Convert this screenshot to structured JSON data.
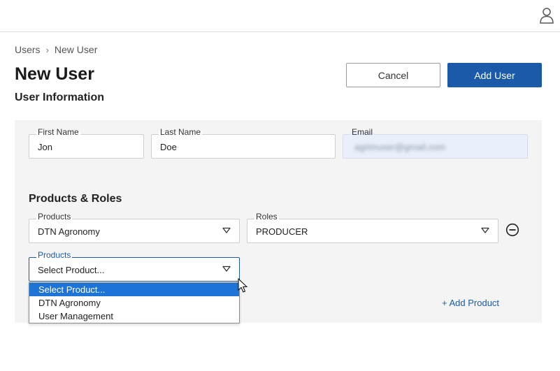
{
  "header": {
    "user_icon": "user-icon"
  },
  "breadcrumb": {
    "items": [
      "Users",
      "New User"
    ],
    "separator": "›"
  },
  "page": {
    "title": "New User",
    "section_title": "User Information"
  },
  "actions": {
    "cancel_label": "Cancel",
    "add_user_label": "Add User"
  },
  "user_info": {
    "first_name": {
      "label": "First Name",
      "value": "Jon"
    },
    "last_name": {
      "label": "Last Name",
      "value": "Doe"
    },
    "email": {
      "label": "Email",
      "value": "agrimuser@gmail.com",
      "obscured": true
    }
  },
  "products_roles": {
    "title": "Products & Roles",
    "row1": {
      "product": {
        "label": "Products",
        "value": "DTN Agronomy"
      },
      "role": {
        "label": "Roles",
        "value": "PRODUCER"
      },
      "remove_icon": "minus-circle-icon"
    },
    "row2": {
      "product": {
        "label": "Products",
        "value": "Select Product..."
      },
      "options": [
        "Select Product...",
        "DTN Agronomy",
        "User Management"
      ],
      "selected_index": 0
    },
    "add_product_label": "+ Add Product"
  },
  "colors": {
    "primary": "#1b5aa8",
    "highlight": "#1e74d6",
    "panel_bg": "#f4f4f4",
    "readonly_bg": "#e9f0fb"
  }
}
